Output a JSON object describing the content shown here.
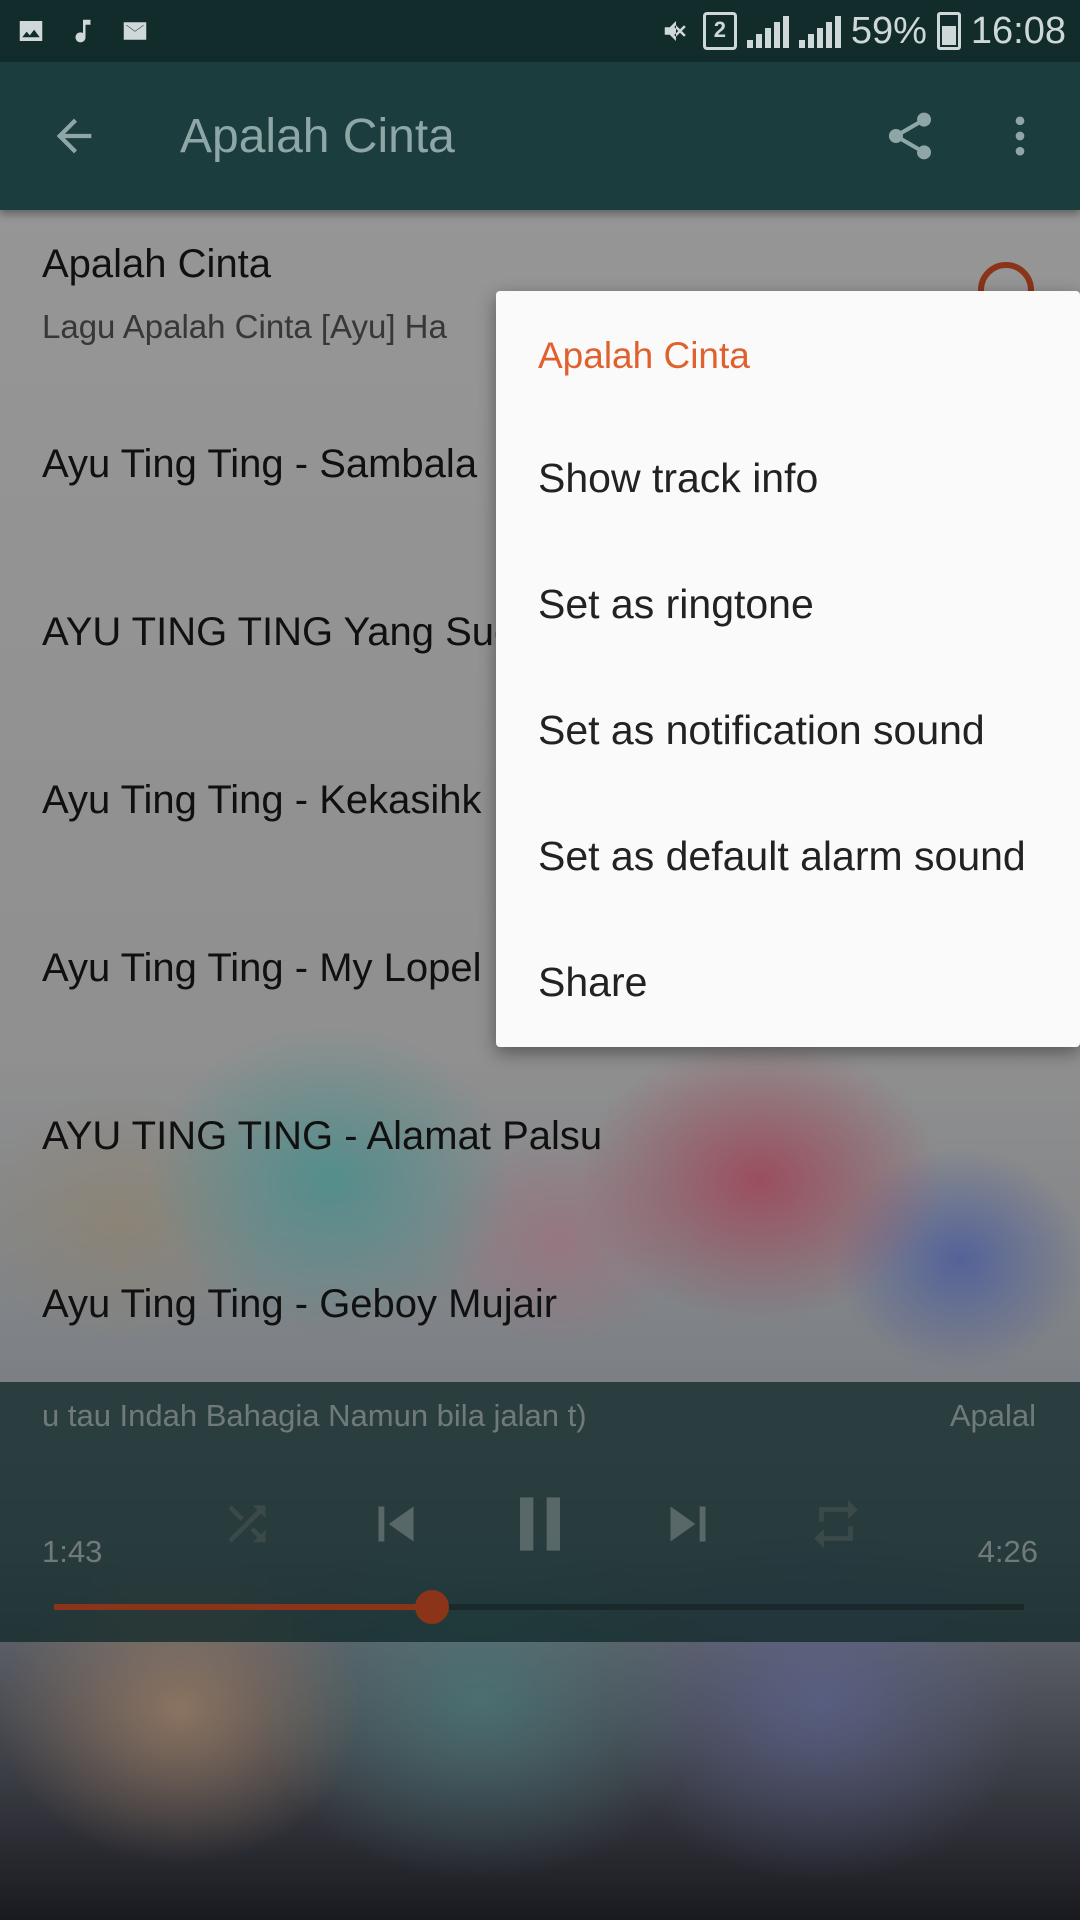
{
  "status_bar": {
    "battery": "59%",
    "time": "16:08",
    "sim_slot": "2"
  },
  "app_bar": {
    "title": "Apalah Cinta"
  },
  "tracks": [
    {
      "title": "Apalah Cinta",
      "subtitle": "Lagu Apalah Cinta  [Ayu]  Ha"
    },
    {
      "title": "Ayu Ting Ting - Sambala"
    },
    {
      "title": "AYU TING TING Yang Suc"
    },
    {
      "title": "Ayu Ting Ting - Kekasihk"
    },
    {
      "title": "Ayu Ting Ting - My Lopel"
    },
    {
      "title": "AYU TING TING - Alamat Palsu"
    },
    {
      "title": "Ayu Ting Ting - Geboy Mujair"
    }
  ],
  "player": {
    "lyrics": "u tau Indah Bahagia  Namun bila jalan t)",
    "now_playing": "Apalal",
    "elapsed": "1:43",
    "duration": "4:26",
    "progress": 0.39
  },
  "menu": {
    "header": "Apalah Cinta",
    "items": [
      "Show track info",
      "Set as ringtone",
      "Set as notification sound",
      "Set as default alarm sound",
      "Share"
    ]
  },
  "colors": {
    "accent": "#e0552a",
    "app_bar": "#1b3d3d",
    "status_bar": "#122c2c"
  }
}
